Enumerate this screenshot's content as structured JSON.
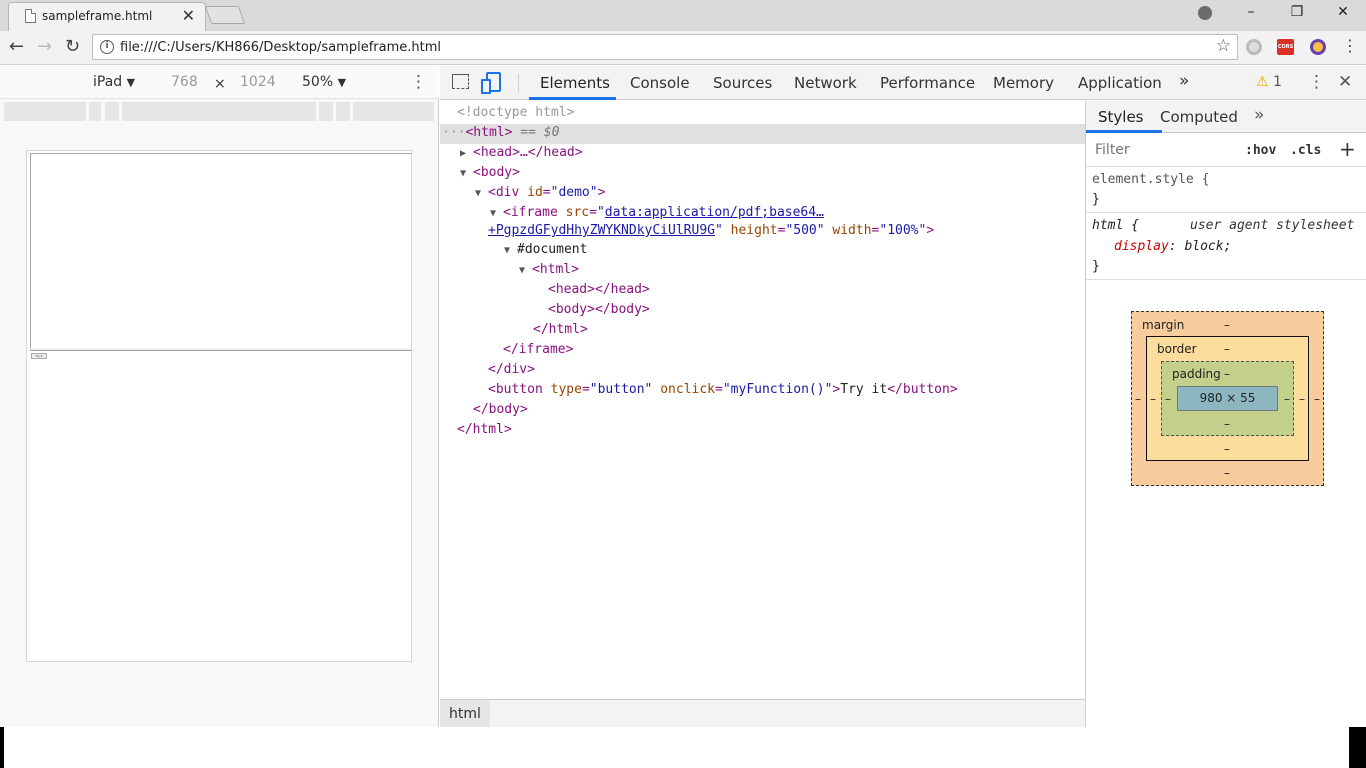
{
  "browser": {
    "tab_title": "sampleframe.html",
    "url": "file:///C:/Users/KH866/Desktop/sampleframe.html",
    "ext_cors_label": "CORS"
  },
  "device_toolbar": {
    "device": "iPad",
    "width": "768",
    "times": "×",
    "height": "1024",
    "zoom": "50%"
  },
  "page_preview": {
    "button_label": "Try it"
  },
  "devtools": {
    "tabs": [
      "Elements",
      "Console",
      "Sources",
      "Network",
      "Performance",
      "Memory",
      "Application"
    ],
    "more": "»",
    "warning_count": "1",
    "dom": {
      "doctype": "<!doctype html>",
      "html_open": "<html>",
      "selected_marker": "== $0",
      "head_collapsed": "<head>…</head>",
      "body_open": "<body>",
      "div_tag": "div",
      "div_attr": "id",
      "div_val": "\"demo\"",
      "iframe_tag": "iframe",
      "iframe_src_attr": "src",
      "iframe_src_line1": "data:application/pdf;base64…",
      "iframe_src_line2": "+PgpzdGFydHhyZWYKNDkyCiUlRU9G",
      "iframe_height_attr": "height",
      "iframe_height_val": "\"500\"",
      "iframe_width_attr": "width",
      "iframe_width_val": "\"100%\"",
      "document": "#document",
      "inner_html_open": "<html>",
      "inner_head": "<head></head>",
      "inner_body": "<body></body>",
      "inner_html_close": "</html>",
      "iframe_close": "</iframe>",
      "div_close": "</div>",
      "button_tag": "button",
      "button_type_attr": "type",
      "button_type_val": "\"button\"",
      "button_onclick_attr": "onclick",
      "button_onclick_val": "\"myFunction()\"",
      "button_text": "Try it",
      "button_close": "</button>",
      "body_close": "</body>",
      "html_close": "</html>"
    },
    "breadcrumb": "html",
    "styles": {
      "tabs": [
        "Styles",
        "Computed"
      ],
      "more": "»",
      "filter_placeholder": "Filter",
      "hov": ":hov",
      "cls": ".cls",
      "add": "+",
      "element_style": "element.style {",
      "close_brace": "}",
      "ua_selector": "html {",
      "ua_source": "user agent stylesheet",
      "ua_prop": "display",
      "ua_value": "block;"
    },
    "box_model": {
      "margin_label": "margin",
      "border_label": "border",
      "padding_label": "padding",
      "dash": "–",
      "content_size": "980 × 55"
    }
  }
}
